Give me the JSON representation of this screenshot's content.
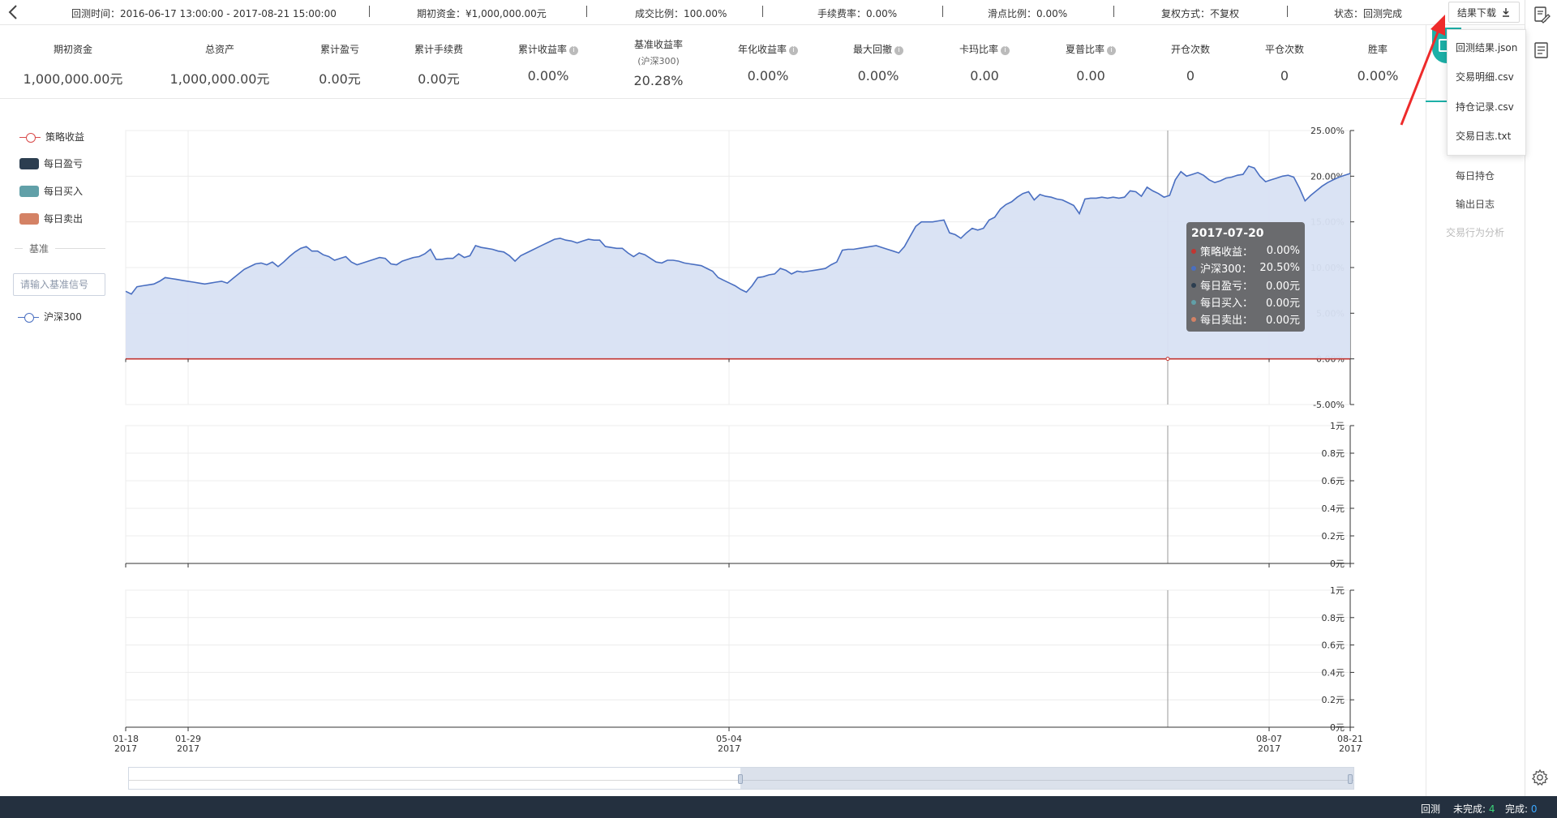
{
  "topbar": {
    "items": [
      {
        "text": "回测时间：2016-06-17 13:00:00 - 2017-08-21 15:00:00"
      },
      {
        "text": "期初资金：¥1,000,000.00元"
      },
      {
        "text": "成交比例：100.00%"
      },
      {
        "text": "手续费率：0.00%"
      },
      {
        "text": "滑点比例：0.00%"
      },
      {
        "text": "复权方式：不复权"
      },
      {
        "text": "状态：回测完成"
      }
    ],
    "download_label": "结果下载"
  },
  "metrics": [
    {
      "label": "期初资金",
      "value": "1,000,000.00元"
    },
    {
      "label": "总资产",
      "value": "1,000,000.00元"
    },
    {
      "label": "累计盈亏",
      "value": "0.00元"
    },
    {
      "label": "累计手续费",
      "value": "0.00元"
    },
    {
      "label": "累计收益率",
      "value": "0.00%"
    },
    {
      "label": "基准收益率",
      "sub": "(沪深300)",
      "value": "20.28%"
    },
    {
      "label": "年化收益率",
      "value": "0.00%"
    },
    {
      "label": "最大回撤",
      "value": "0.00%"
    },
    {
      "label": "卡玛比率",
      "value": "0.00"
    },
    {
      "label": "夏普比率",
      "value": "0.00"
    },
    {
      "label": "开仓次数",
      "value": "0"
    },
    {
      "label": "平仓次数",
      "value": "0"
    },
    {
      "label": "胜率",
      "value": "0.00%"
    }
  ],
  "legend": {
    "items": [
      {
        "label": "策略收益",
        "color": "#d94a4a"
      },
      {
        "label": "每日盈亏",
        "color": "#2c3e50"
      },
      {
        "label": "每日买入",
        "color": "#61a0a8"
      },
      {
        "label": "每日卖出",
        "color": "#d48265"
      }
    ],
    "benchmark_title": "基准",
    "benchmark_placeholder": "请输入基准信号",
    "benchmark_item": {
      "label": "沪深300",
      "color": "#4a6fc1"
    }
  },
  "tooltip": {
    "date": "2017-07-20",
    "rows": [
      {
        "name": "策略收益：",
        "value": "0.00%",
        "color": "#c23531"
      },
      {
        "name": "沪深300：",
        "value": "20.50%",
        "color": "#4a6fc1"
      },
      {
        "name": "每日盈亏：",
        "value": "0.00元",
        "color": "#2c3e50"
      },
      {
        "name": "每日买入：",
        "value": "0.00元",
        "color": "#61a0a8"
      },
      {
        "name": "每日卖出：",
        "value": "0.00元",
        "color": "#d48265"
      }
    ]
  },
  "dropdown": {
    "items": [
      "回测结果.json",
      "交易明细.csv",
      "持仓记录.csv",
      "交易日志.txt"
    ]
  },
  "right_panel": {
    "items": [
      {
        "label": "每日持仓",
        "enabled": true
      },
      {
        "label": "输出日志",
        "enabled": true
      },
      {
        "label": "交易行为分析",
        "enabled": false
      }
    ]
  },
  "statusbar": {
    "mode": "回测",
    "pending_label": "未完成:",
    "pending_count": "4",
    "done_label": "完成:",
    "done_count": "0"
  },
  "chart_data": {
    "type": "line",
    "x_ticks": [
      {
        "label": "01-18",
        "year": "2017"
      },
      {
        "label": "01-29",
        "year": "2017"
      },
      {
        "label": "05-04",
        "year": "2017"
      },
      {
        "label": "08-07",
        "year": "2017"
      },
      {
        "label": "08-21",
        "year": "2017"
      }
    ],
    "panels": [
      {
        "y_ticks": [
          "25.00%",
          "20.00%",
          "15.00%",
          "10.00%",
          "5.00%",
          "0.00%",
          "-5.00%"
        ],
        "ylim": [
          -5,
          25
        ],
        "series": [
          {
            "name": "沪深300",
            "color": "#4a6fc1",
            "fill": "#d8e2f3",
            "values": [
              7.4,
              7.1,
              7.9,
              8.0,
              8.1,
              8.2,
              8.5,
              8.9,
              8.8,
              8.7,
              8.6,
              8.5,
              8.4,
              8.3,
              8.2,
              8.3,
              8.4,
              8.5,
              8.3,
              8.8,
              9.3,
              9.8,
              10.1,
              10.4,
              10.5,
              10.3,
              10.6,
              10.1,
              10.6,
              11.2,
              11.7,
              12.1,
              12.3,
              11.8,
              11.8,
              11.4,
              11.2,
              10.8,
              11.0,
              11.2,
              10.6,
              10.3,
              10.5,
              10.7,
              10.9,
              11.1,
              11.0,
              10.4,
              10.3,
              10.7,
              10.9,
              11.1,
              11.2,
              11.5,
              12.0,
              10.9,
              10.9,
              11.0,
              11.0,
              11.5,
              11.1,
              11.3,
              12.4,
              12.2,
              12.1,
              12.0,
              11.8,
              11.7,
              11.3,
              10.7,
              11.3,
              11.6,
              11.9,
              12.2,
              12.5,
              12.8,
              13.1,
              13.2,
              13.0,
              12.9,
              12.7,
              12.9,
              13.1,
              13.0,
              13.0,
              12.3,
              12.2,
              12.1,
              12.1,
              11.6,
              11.2,
              11.6,
              11.4,
              11.0,
              10.6,
              10.5,
              10.8,
              10.8,
              10.7,
              10.5,
              10.4,
              10.3,
              10.2,
              9.9,
              9.6,
              8.9,
              8.6,
              8.3,
              8.0,
              7.6,
              7.3,
              8.0,
              8.9,
              9.0,
              9.2,
              9.3,
              9.9,
              9.7,
              9.3,
              9.6,
              9.5,
              9.6,
              9.7,
              9.8,
              9.9,
              10.3,
              10.6,
              11.9,
              12.0,
              12.0,
              12.1,
              12.2,
              12.3,
              12.4,
              12.2,
              12.0,
              11.8,
              11.6,
              12.3,
              13.4,
              14.5,
              15.0,
              15.0,
              15.0,
              15.1,
              15.2,
              13.8,
              13.6,
              13.2,
              13.8,
              14.3,
              14.1,
              14.3,
              15.2,
              15.5,
              16.4,
              16.9,
              17.2,
              17.7,
              18.1,
              18.3,
              17.4,
              18.0,
              17.8,
              17.7,
              17.5,
              17.4,
              17.1,
              16.8,
              15.9,
              17.5,
              17.6,
              17.6,
              17.7,
              17.6,
              17.7,
              17.6,
              17.7,
              18.4,
              18.3,
              17.8,
              18.8,
              18.4,
              18.1,
              17.7,
              17.9,
              19.6,
              20.5,
              20.0,
              20.2,
              20.4,
              20.1,
              19.6,
              19.3,
              19.5,
              19.8,
              19.9,
              20.1,
              20.2,
              21.1,
              20.9,
              20.0,
              19.4,
              19.6,
              19.8,
              20.0,
              20.1,
              19.9,
              18.7,
              17.3,
              17.9,
              18.4,
              18.9,
              19.3,
              19.6,
              19.9,
              20.1,
              20.3
            ]
          },
          {
            "name": "策略收益",
            "color": "#c23531",
            "values_constant": 0
          }
        ]
      },
      {
        "y_ticks": [
          "1元",
          "0.8元",
          "0.6元",
          "0.4元",
          "0.2元",
          "0元"
        ],
        "ylim": [
          0,
          1
        ]
      },
      {
        "y_ticks": [
          "1元",
          "0.8元",
          "0.6元",
          "0.4元",
          "0.2元",
          "0元"
        ],
        "ylim": [
          0,
          1
        ]
      }
    ],
    "hover_date": "2017-07-20",
    "zoom_range": [
      0.5,
      1.0
    ]
  }
}
